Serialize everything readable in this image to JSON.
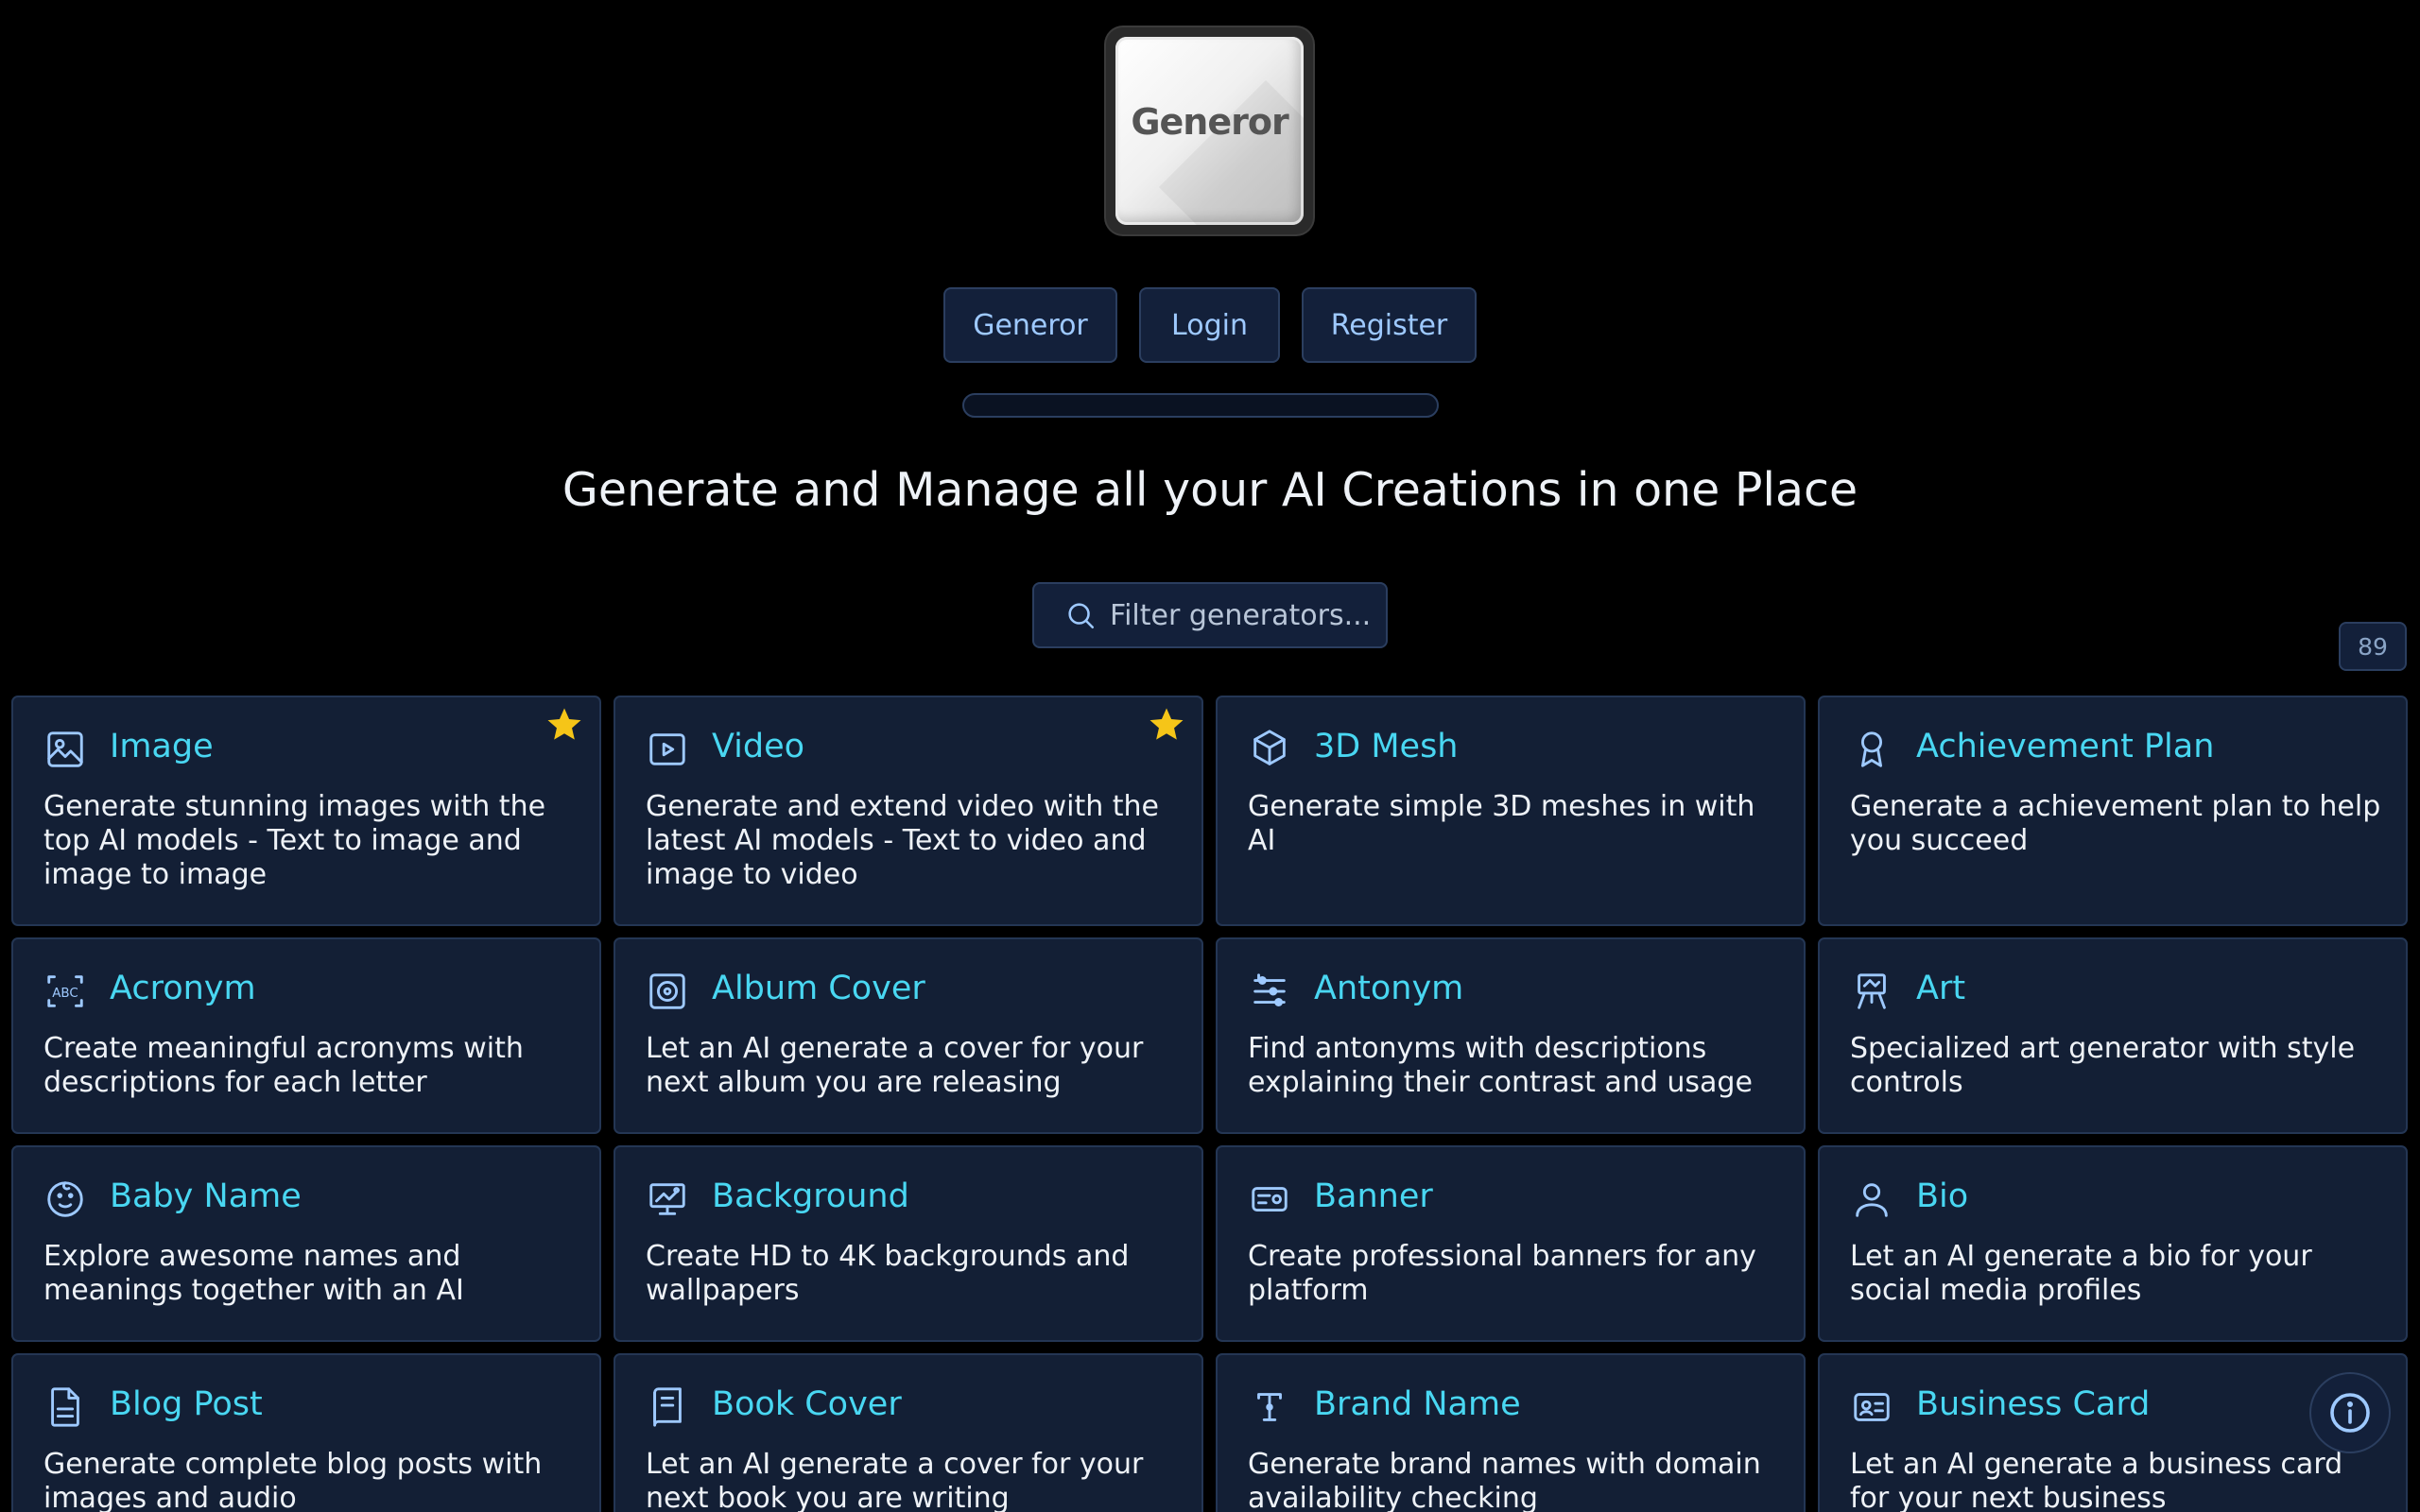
{
  "logo": {
    "text": "Generor"
  },
  "nav": [
    {
      "label": "Generor"
    },
    {
      "label": "Login"
    },
    {
      "label": "Register"
    }
  ],
  "headline": "Generate and Manage all your AI Creations in one Place",
  "search": {
    "placeholder": "Filter generators...",
    "value": ""
  },
  "count": "89",
  "colors": {
    "accent": "#49d7f2",
    "card_bg": "#131f35",
    "star": "#f5c518"
  },
  "cards": [
    {
      "title": "Image",
      "desc": "Generate stunning images with the top AI models - Text to image and image to image",
      "icon": "image-icon",
      "starred": true
    },
    {
      "title": "Video",
      "desc": "Generate and extend video with the latest AI models - Text to video and image to video",
      "icon": "video-icon",
      "starred": true
    },
    {
      "title": "3D Mesh",
      "desc": "Generate simple 3D meshes in with AI",
      "icon": "cube-icon",
      "starred": false
    },
    {
      "title": "Achievement Plan",
      "desc": "Generate a achievement plan to help you succeed",
      "icon": "award-icon",
      "starred": false
    },
    {
      "title": "Acronym",
      "desc": "Create meaningful acronyms with descriptions for each letter",
      "icon": "abc-icon",
      "starred": false
    },
    {
      "title": "Album Cover",
      "desc": "Let an AI generate a cover for your next album you are releasing",
      "icon": "disc-icon",
      "starred": false
    },
    {
      "title": "Antonym",
      "desc": "Find antonyms with descriptions explaining their contrast and usage",
      "icon": "sliders-icon",
      "starred": false
    },
    {
      "title": "Art",
      "desc": "Specialized art generator with style controls",
      "icon": "easel-icon",
      "starred": false
    },
    {
      "title": "Baby Name",
      "desc": "Explore awesome names and meanings together with an AI",
      "icon": "baby-icon",
      "starred": false
    },
    {
      "title": "Background",
      "desc": "Create HD to 4K backgrounds and wallpapers",
      "icon": "monitor-icon",
      "starred": false
    },
    {
      "title": "Banner",
      "desc": "Create professional banners for any platform",
      "icon": "banner-icon",
      "starred": false
    },
    {
      "title": "Bio",
      "desc": "Let an AI generate a bio for your social media profiles",
      "icon": "user-icon",
      "starred": false
    },
    {
      "title": "Blog Post",
      "desc": "Generate complete blog posts with images and audio",
      "icon": "document-icon",
      "starred": false
    },
    {
      "title": "Book Cover",
      "desc": "Let an AI generate a cover for your next book you are writing",
      "icon": "book-icon",
      "starred": false
    },
    {
      "title": "Brand Name",
      "desc": "Generate brand names with domain availability checking",
      "icon": "typography-icon",
      "starred": false
    },
    {
      "title": "Business Card",
      "desc": "Let an AI generate a business card for your next business",
      "icon": "id-card-icon",
      "starred": false
    }
  ]
}
